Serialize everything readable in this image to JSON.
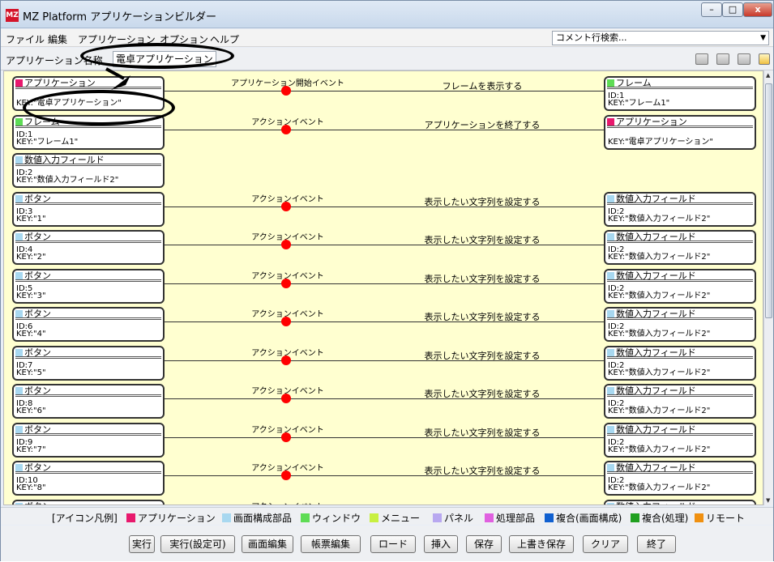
{
  "window": {
    "title": "MZ Platform アプリケーションビルダー",
    "app_icon": "MZ",
    "min_label": "–",
    "max_label": "□",
    "close_label": "x"
  },
  "menu": {
    "items": [
      "ファイル",
      "編集",
      "アプリケーション",
      "オプション",
      "ヘルプ"
    ],
    "search_placeholder": "コメント行検索..."
  },
  "name_bar": {
    "label": "アプリケーション名称",
    "value": "電卓アプリケーション"
  },
  "rows": [
    {
      "src_icon": "app",
      "src_title": "アプリケーション",
      "src_id": "",
      "src_key": "KEY:\"電卓アプリケーション\"",
      "event": "アプリケーション開始イベント",
      "action": "フレームを表示する",
      "dst_icon": "win",
      "dst_title": "フレーム",
      "dst_id": "ID:1",
      "dst_key": "KEY:\"フレーム1\""
    },
    {
      "src_icon": "win",
      "src_title": "フレーム",
      "src_id": "ID:1",
      "src_key": "KEY:\"フレーム1\"",
      "event": "アクションイベント",
      "action": "アプリケーションを終了する",
      "dst_icon": "app",
      "dst_title": "アプリケーション",
      "dst_id": "",
      "dst_key": "KEY:\"電卓アプリケーション\""
    },
    {
      "src_icon": "scr",
      "src_title": "数値入力フィールド",
      "src_id": "ID:2",
      "src_key": "KEY:\"数値入力フィールド2\"",
      "event": "",
      "action": "",
      "dst_icon": "",
      "dst_title": "",
      "dst_id": "",
      "dst_key": ""
    },
    {
      "src_icon": "scr",
      "src_title": "ボタン",
      "src_id": "ID:3",
      "src_key": "KEY:\"1\"",
      "event": "アクションイベント",
      "action": "表示したい文字列を設定する",
      "dst_icon": "scr",
      "dst_title": "数値入力フィールド",
      "dst_id": "ID:2",
      "dst_key": "KEY:\"数値入力フィールド2\""
    },
    {
      "src_icon": "scr",
      "src_title": "ボタン",
      "src_id": "ID:4",
      "src_key": "KEY:\"2\"",
      "event": "アクションイベント",
      "action": "表示したい文字列を設定する",
      "dst_icon": "scr",
      "dst_title": "数値入力フィールド",
      "dst_id": "ID:2",
      "dst_key": "KEY:\"数値入力フィールド2\""
    },
    {
      "src_icon": "scr",
      "src_title": "ボタン",
      "src_id": "ID:5",
      "src_key": "KEY:\"3\"",
      "event": "アクションイベント",
      "action": "表示したい文字列を設定する",
      "dst_icon": "scr",
      "dst_title": "数値入力フィールド",
      "dst_id": "ID:2",
      "dst_key": "KEY:\"数値入力フィールド2\""
    },
    {
      "src_icon": "scr",
      "src_title": "ボタン",
      "src_id": "ID:6",
      "src_key": "KEY:\"4\"",
      "event": "アクションイベント",
      "action": "表示したい文字列を設定する",
      "dst_icon": "scr",
      "dst_title": "数値入力フィールド",
      "dst_id": "ID:2",
      "dst_key": "KEY:\"数値入力フィールド2\""
    },
    {
      "src_icon": "scr",
      "src_title": "ボタン",
      "src_id": "ID:7",
      "src_key": "KEY:\"5\"",
      "event": "アクションイベント",
      "action": "表示したい文字列を設定する",
      "dst_icon": "scr",
      "dst_title": "数値入力フィールド",
      "dst_id": "ID:2",
      "dst_key": "KEY:\"数値入力フィールド2\""
    },
    {
      "src_icon": "scr",
      "src_title": "ボタン",
      "src_id": "ID:8",
      "src_key": "KEY:\"6\"",
      "event": "アクションイベント",
      "action": "表示したい文字列を設定する",
      "dst_icon": "scr",
      "dst_title": "数値入力フィールド",
      "dst_id": "ID:2",
      "dst_key": "KEY:\"数値入力フィールド2\""
    },
    {
      "src_icon": "scr",
      "src_title": "ボタン",
      "src_id": "ID:9",
      "src_key": "KEY:\"7\"",
      "event": "アクションイベント",
      "action": "表示したい文字列を設定する",
      "dst_icon": "scr",
      "dst_title": "数値入力フィールド",
      "dst_id": "ID:2",
      "dst_key": "KEY:\"数値入力フィールド2\""
    },
    {
      "src_icon": "scr",
      "src_title": "ボタン",
      "src_id": "ID:10",
      "src_key": "KEY:\"8\"",
      "event": "アクションイベント",
      "action": "表示したい文字列を設定する",
      "dst_icon": "scr",
      "dst_title": "数値入力フィールド",
      "dst_id": "ID:2",
      "dst_key": "KEY:\"数値入力フィールド2\""
    },
    {
      "src_icon": "scr",
      "src_title": "ボタン",
      "src_id": "",
      "src_key": "",
      "event": "アクションイベント",
      "action": "",
      "dst_icon": "scr",
      "dst_title": "数値入力フィールド",
      "dst_id": "",
      "dst_key": ""
    }
  ],
  "legend": {
    "title": "[アイコン凡例]",
    "items": [
      {
        "label": "アプリケーション",
        "color": "#e8196d"
      },
      {
        "label": "画面構成部品",
        "color": "#a8d8f0"
      },
      {
        "label": "ウィンドウ",
        "color": "#5edc55"
      },
      {
        "label": "メニュー",
        "color": "#c8f040"
      },
      {
        "label": "パネル",
        "color": "#b8a8f0"
      },
      {
        "label": "処理部品",
        "color": "#e060e0"
      },
      {
        "label": "複合(画面構成)",
        "color": "#1060d0"
      },
      {
        "label": "複合(処理)",
        "color": "#20a020"
      },
      {
        "label": "リモート",
        "color": "#f09010"
      }
    ]
  },
  "buttons": [
    "実行",
    "実行(設定可)",
    "画面編集",
    "帳票編集",
    "ロード",
    "挿入",
    "保存",
    "上書き保存",
    "クリア",
    "終了"
  ],
  "colors": {
    "canvas_bg": "#ffffd0",
    "event_dot": "#ff0000"
  }
}
